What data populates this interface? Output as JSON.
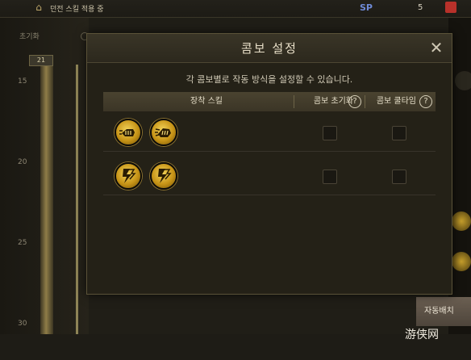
{
  "background": {
    "top_text": "던전 스킬 적용 중",
    "sp_label": "SP",
    "sp_value": "5",
    "init_label": "초기화",
    "track_top": "21",
    "level_numbers": [
      "15",
      "20",
      "25",
      "30"
    ],
    "auto_button": "자동배치",
    "watermark": "游侠网"
  },
  "modal": {
    "title": "콤보 설정",
    "description": "각 콤보별로 작동 방식을 설정할 수 있습니다.",
    "columns": {
      "skill": "장착 스킬",
      "reset": "콤보 초기화",
      "cooltime": "콤보 쿨타임"
    },
    "help_glyph": "?",
    "close_glyph": "✕",
    "combos": [
      {
        "icons": [
          "fist-strike-icon",
          "fist-strike-icon"
        ],
        "reset": false,
        "cooltime": false
      },
      {
        "icons": [
          "lightning-slash-icon",
          "lightning-slash-icon"
        ],
        "reset": false,
        "cooltime": false
      }
    ]
  }
}
